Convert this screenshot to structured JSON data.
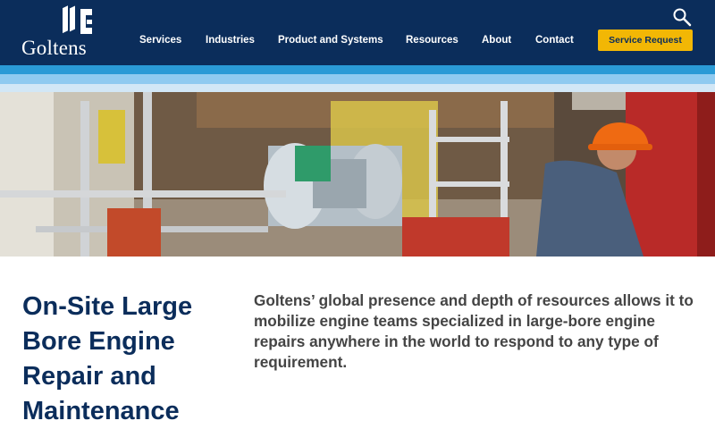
{
  "brand": {
    "name": "Goltens"
  },
  "header": {
    "nav": [
      {
        "label": "Services"
      },
      {
        "label": "Industries"
      },
      {
        "label": "Product and Systems"
      },
      {
        "label": "Resources"
      },
      {
        "label": "About"
      },
      {
        "label": "Contact"
      }
    ],
    "cta_label": "Service Request",
    "search_icon": "magnifier-icon"
  },
  "colors": {
    "header_bg": "#0b2d5b",
    "accent": "#f2b705",
    "stripe_1": "#2a9ad6",
    "stripe_2": "#8fcaf0",
    "stripe_3": "#d2e7f6",
    "title": "#0b2d5b"
  },
  "main": {
    "title": "On-Site Large Bore Engine Repair and Maintenance",
    "intro": "Goltens’ global presence and depth of resources allows it to mobilize engine teams specialized in large-bore engine repairs anywhere in the world to respond to any type of requirement."
  }
}
